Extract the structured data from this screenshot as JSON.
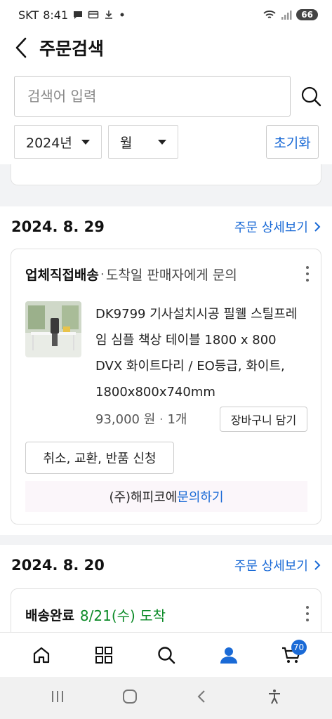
{
  "status_bar": {
    "carrier": "SKT",
    "time": "8:41",
    "battery": "66"
  },
  "header": {
    "title": "주문검색"
  },
  "search": {
    "placeholder": "검색어 입력"
  },
  "filters": {
    "year": "2024년",
    "month": "월",
    "reset_label": "초기화"
  },
  "orders": [
    {
      "date": "2024. 8. 29",
      "detail_link": "주문 상세보기",
      "status": "업체직접배송",
      "status_note": "도착일 판매자에게 문의",
      "product_name": "DK9799 기사설치시공 필웰 스틸프레임 심플 책상 테이블 1800 x 800 DVX 화이트다리 / EO등급, 화이트, 1800x800x740mm",
      "price": "93,000 원",
      "quantity": "1개",
      "cart_label": "장바구니 담기",
      "claim_label": "취소, 교환, 반품 신청",
      "inquiry_prefix": "(주)해피코에",
      "inquiry_link": "문의하기"
    },
    {
      "date": "2024. 8. 20",
      "detail_link": "주문 상세보기",
      "status": "배송완료",
      "arrival": "8/21(수) 도착"
    }
  ],
  "bottom_nav": {
    "cart_count": "70"
  },
  "colors": {
    "link": "#1a6ad6",
    "delivered": "#0b8a27",
    "active_tab": "#1a6ad6"
  }
}
